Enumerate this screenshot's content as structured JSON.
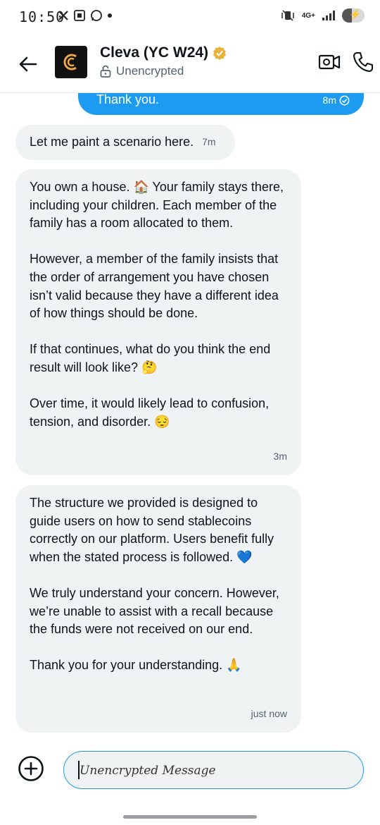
{
  "status_bar": {
    "time": "10:50",
    "network": "4G+",
    "left_icons": [
      "x-logo-icon",
      "screen-icon",
      "whatsapp-icon",
      "dot-icon"
    ],
    "right_icons": [
      "mute-vibrate-icon",
      "network-4g-icon",
      "signal-icon",
      "battery-charging-icon"
    ]
  },
  "header": {
    "contact_name": "Cleva (YC W24)",
    "encryption_status": "Unencrypted",
    "icons": [
      "back-arrow-icon",
      "verified-badge-icon",
      "lock-open-icon",
      "video-call-icon",
      "phone-icon"
    ]
  },
  "messages": [
    {
      "direction": "outgoing",
      "text": "Thank you.",
      "time": "8m",
      "status_icon": "check-circle-icon"
    },
    {
      "direction": "incoming",
      "text": "Let me paint a scenario here.",
      "time": "7m"
    },
    {
      "direction": "incoming",
      "text": "You own a house. 🏠 Your family stays there, including your children. Each member of the family has a room allocated to them.\n\nHowever, a member of the family insists that the order of arrangement you have chosen isn’t valid because they have a different idea of how things should be done.\n\nIf that continues, what do you think the end result will look like? 🤔\n\nOver time, it would likely lead to confusion, tension, and disorder. 😔",
      "time": "3m"
    },
    {
      "direction": "incoming",
      "text": "The structure we provided is designed to guide users on how to send stablecoins correctly on our platform. Users benefit fully when the stated process is followed. 💙\n\nWe truly understand your concern. However, we’re unable to assist with a recall because the funds were not received on our end.\n\nThank you for your understanding. 🙏",
      "time": "just now"
    }
  ],
  "composer": {
    "placeholder": "Unencrypted Message",
    "add_icon": "plus-circle-icon"
  },
  "colors": {
    "accent": "#1d9bf0",
    "bubble_incoming": "#eff3f4",
    "verified_gold": "#e8b33c"
  }
}
